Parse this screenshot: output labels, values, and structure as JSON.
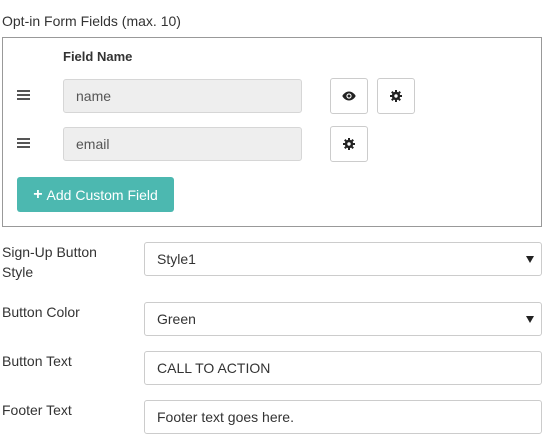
{
  "section_title": "Opt-in Form Fields (max. 10)",
  "fields_table": {
    "column_header": "Field Name",
    "rows": [
      {
        "value": "name",
        "has_visibility": true,
        "has_settings": true
      },
      {
        "value": "email",
        "has_visibility": false,
        "has_settings": true
      }
    ],
    "add_button_label": "Add Custom Field",
    "add_button_color": "#4cb8b0"
  },
  "settings": {
    "signup_style_label": "Sign-Up Button Style",
    "signup_style_value": "Style1",
    "button_color_label": "Button Color",
    "button_color_value": "Green",
    "button_text_label": "Button Text",
    "button_text_value": "CALL TO ACTION",
    "footer_text_label": "Footer Text",
    "footer_text_value": "Footer text goes here."
  }
}
